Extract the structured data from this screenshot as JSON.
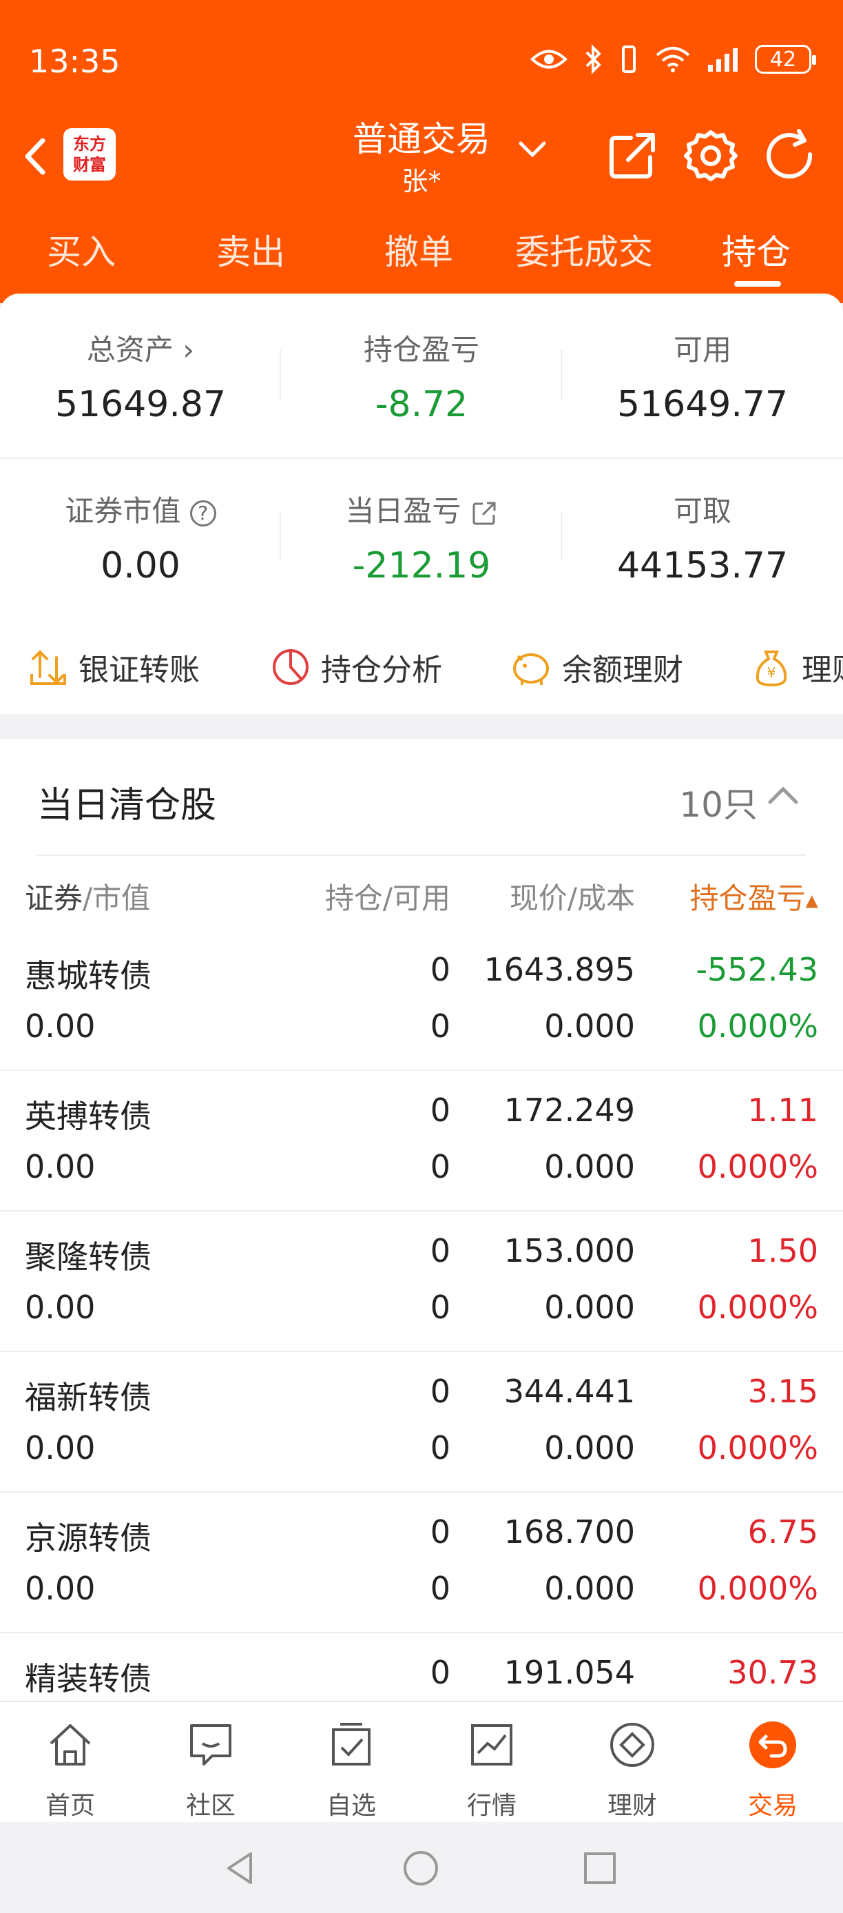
{
  "status_bar": {
    "time": "13:35",
    "battery": "42"
  },
  "header": {
    "logo_text": "东方财富",
    "title": "普通交易",
    "account": "张*",
    "tabs": [
      "买入",
      "卖出",
      "撤单",
      "委托成交",
      "持仓"
    ],
    "active_tab": "持仓"
  },
  "summary": {
    "total_assets_label": "总资产",
    "total_assets": "51649.87",
    "position_pl_label": "持仓盈亏",
    "position_pl": "-8.72",
    "available_label": "可用",
    "available": "51649.77",
    "market_value_label": "证券市值",
    "market_value": "0.00",
    "daily_pl_label": "当日盈亏",
    "daily_pl": "-212.19",
    "withdrawable_label": "可取",
    "withdrawable": "44153.77"
  },
  "quick_actions": [
    "银证转账",
    "持仓分析",
    "余额理财",
    "理财"
  ],
  "holdings": {
    "section_title": "当日清仓股",
    "count": "10只",
    "columns": {
      "security_a": "证券",
      "security_b": "/市值",
      "position": "持仓/可用",
      "price": "现价/成本",
      "pl": "持仓盈亏"
    },
    "rows": [
      {
        "name": "惠城转债",
        "mv": "0.00",
        "pos": "0",
        "avail": "0",
        "price": "1643.895",
        "cost": "0.000",
        "pl": "-552.43",
        "pl_pct": "0.000%"
      },
      {
        "name": "英搏转债",
        "mv": "0.00",
        "pos": "0",
        "avail": "0",
        "price": "172.249",
        "cost": "0.000",
        "pl": "1.11",
        "pl_pct": "0.000%"
      },
      {
        "name": "聚隆转债",
        "mv": "0.00",
        "pos": "0",
        "avail": "0",
        "price": "153.000",
        "cost": "0.000",
        "pl": "1.50",
        "pl_pct": "0.000%"
      },
      {
        "name": "福新转债",
        "mv": "0.00",
        "pos": "0",
        "avail": "0",
        "price": "344.441",
        "cost": "0.000",
        "pl": "3.15",
        "pl_pct": "0.000%"
      },
      {
        "name": "京源转债",
        "mv": "0.00",
        "pos": "0",
        "avail": "0",
        "price": "168.700",
        "cost": "0.000",
        "pl": "6.75",
        "pl_pct": "0.000%"
      },
      {
        "name": "精装转债",
        "mv": "",
        "pos": "0",
        "avail": "",
        "price": "191.054",
        "cost": "",
        "pl": "30.73",
        "pl_pct": ""
      }
    ]
  },
  "bottom_nav": [
    "首页",
    "社区",
    "自选",
    "行情",
    "理财",
    "交易"
  ],
  "active_nav": "交易",
  "colors": {
    "brand": "#ff5500",
    "loss": "#1a9b35",
    "gain": "#e0242c"
  }
}
